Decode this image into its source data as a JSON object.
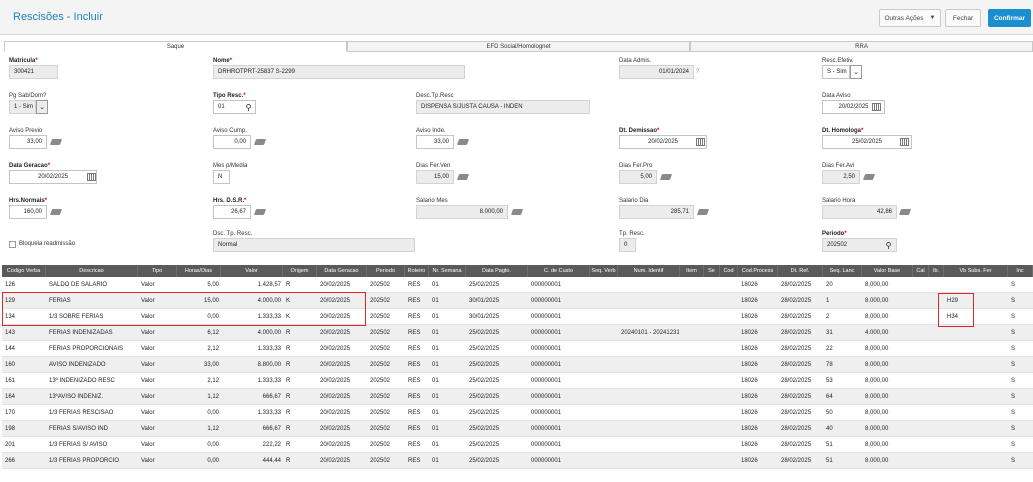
{
  "header": {
    "title": "Rescisões - Incluir",
    "actions": {
      "outras_acoes": "Outras Ações",
      "fechar": "Fechar",
      "confirmar": "Confirmar"
    }
  },
  "tabs": [
    "Saque",
    "EFD Social/Homolognet",
    "RRA"
  ],
  "form": {
    "matricula": {
      "label": "Matricula",
      "value": "300421"
    },
    "nome": {
      "label": "Nome",
      "value": "DRHROTPRT-25837  S-2299"
    },
    "data_admis": {
      "label": "Data Admis.",
      "value": "01/01/2024",
      "help": "?"
    },
    "resc_efetiv": {
      "label": "Resc.Efetiv.",
      "value": "S - Sim"
    },
    "pg_sab_dom": {
      "label": "Pg Sab/Dom?",
      "value": "1 - Sim"
    },
    "tipo_resc": {
      "label": "Tipo Resc.",
      "value": "01"
    },
    "desc_tp_resc": {
      "label": "Desc.Tp.Resc",
      "value": "DISPENSA S/JUSTA CAUSA - INDEN"
    },
    "data_aviso": {
      "label": "Data Aviso",
      "value": "20/02/2025"
    },
    "aviso_previo": {
      "label": "Aviso Previo",
      "value": "33,00"
    },
    "aviso_cump": {
      "label": "Aviso Cump.",
      "value": "0,00"
    },
    "aviso_inde": {
      "label": "Aviso Inde.",
      "value": "33,00"
    },
    "dt_demissao": {
      "label": "Dt. Demissao",
      "value": "20/02/2025"
    },
    "dt_homologa": {
      "label": "Dt. Homologa",
      "value": "25/02/2025"
    },
    "data_geracao": {
      "label": "Data Geracao",
      "value": "20/02/2025"
    },
    "mes_p_media": {
      "label": "Mes p/Media",
      "value": "N"
    },
    "dias_fer_ven": {
      "label": "Dias Fer.Ven",
      "value": "15,00"
    },
    "dias_fer_pro": {
      "label": "Dias Fer.Pro",
      "value": "5,00"
    },
    "dias_fer_avi": {
      "label": "Dias Fer.Avi",
      "value": "2,50"
    },
    "hrs_normais": {
      "label": "Hrs.Normais",
      "value": "160,00"
    },
    "hrs_dsr": {
      "label": "Hrs. D.S.R.",
      "value": "26,67"
    },
    "salario_mes": {
      "label": "Salario Mes",
      "value": "8.000,00"
    },
    "salario_dia": {
      "label": "Salario Dia",
      "value": "285,71"
    },
    "salario_hora": {
      "label": "Salario Hora",
      "value": "42,86"
    },
    "bloqueia": {
      "label": "Bloqueia readmissão"
    },
    "dsc_tp_resc": {
      "label": "Dsc. Tp. Resc.",
      "value": "Normal"
    },
    "tp_resc": {
      "label": "Tp. Resc.",
      "value": "0"
    },
    "periodo": {
      "label": "Periodo",
      "value": "202502"
    }
  },
  "grid": {
    "headers": [
      "Codigo Verba",
      "Descricao",
      "Tipo",
      "Horas/Dias",
      "Valor",
      "Origem",
      "Data Geracao",
      "Periodo",
      "Roteiro",
      "Nr. Semana",
      "Data Pagto.",
      "C. de Custo",
      "Seq. Verb",
      "Num. Identif",
      "Item",
      "Se",
      "Cod",
      "Cod.Process",
      "Dt. Ref.",
      "Seq. Lanc",
      "Valor Base",
      "Cal",
      "Ib.",
      "Vb Subs. Fer",
      "Inc"
    ],
    "rows": [
      [
        "126",
        "SALDO DE SALARIO",
        "Valor",
        "5,00",
        "1.428,57",
        "R",
        "20/02/2025",
        "202502",
        "RES",
        "01",
        "25/02/2025",
        "000000001",
        "",
        "",
        "",
        "",
        "",
        "18026",
        "28/02/2025",
        "20",
        "8.000,00",
        "",
        "",
        "",
        "S"
      ],
      [
        "129",
        "FERIAS",
        "Valor",
        "15,00",
        "4.000,00",
        "K",
        "20/02/2025",
        "202502",
        "RES",
        "01",
        "30/01/2025",
        "000000001",
        "",
        "",
        "",
        "",
        "",
        "18026",
        "28/02/2025",
        "1",
        "8.000,00",
        "",
        "",
        "H29",
        "S"
      ],
      [
        "134",
        "1/3 SOBRE FERIAS",
        "Valor",
        "0,00",
        "1.333,33",
        "K",
        "20/02/2025",
        "202502",
        "RES",
        "01",
        "30/01/2025",
        "000000001",
        "",
        "",
        "",
        "",
        "",
        "18026",
        "28/02/2025",
        "2",
        "8.000,00",
        "",
        "",
        "H34",
        "S"
      ],
      [
        "143",
        "FERIAS INDENIZADAS",
        "Valor",
        "6,12",
        "4.000,00",
        "R",
        "20/02/2025",
        "202502",
        "RES",
        "01",
        "25/02/2025",
        "000000001",
        "",
        "20240101 - 20241231",
        "",
        "",
        "",
        "18026",
        "28/02/2025",
        "31",
        "4.000,00",
        "",
        "",
        "",
        "S"
      ],
      [
        "144",
        "FERIAS PROPORCIONAIS",
        "Valor",
        "2,12",
        "1.333,33",
        "R",
        "20/02/2025",
        "202502",
        "RES",
        "01",
        "25/02/2025",
        "000000001",
        "",
        "",
        "",
        "",
        "",
        "18026",
        "28/02/2025",
        "22",
        "8.000,00",
        "",
        "",
        "",
        "S"
      ],
      [
        "160",
        "AVISO INDENIZADO",
        "Valor",
        "33,00",
        "8.800,00",
        "R",
        "20/02/2025",
        "202502",
        "RES",
        "01",
        "25/02/2025",
        "000000001",
        "",
        "",
        "",
        "",
        "",
        "18026",
        "28/02/2025",
        "78",
        "8.000,00",
        "",
        "",
        "",
        "S"
      ],
      [
        "161",
        "13º INDENIZADO RESC",
        "Valor",
        "2,12",
        "1.333,33",
        "R",
        "20/02/2025",
        "202502",
        "RES",
        "01",
        "25/02/2025",
        "000000001",
        "",
        "",
        "",
        "",
        "",
        "18026",
        "28/02/2025",
        "53",
        "8.000,00",
        "",
        "",
        "",
        "S"
      ],
      [
        "164",
        "13ºAVISO INDENIZ.",
        "Valor",
        "1,12",
        "666,67",
        "R",
        "20/02/2025",
        "202502",
        "RES",
        "01",
        "25/02/2025",
        "000000001",
        "",
        "",
        "",
        "",
        "",
        "18026",
        "28/02/2025",
        "64",
        "8.000,00",
        "",
        "",
        "",
        "S"
      ],
      [
        "170",
        "1/3 FERIAS RESCISAO",
        "Valor",
        "0,00",
        "1.333,33",
        "R",
        "20/02/2025",
        "202502",
        "RES",
        "01",
        "25/02/2025",
        "000000001",
        "",
        "",
        "",
        "",
        "",
        "18026",
        "28/02/2025",
        "50",
        "8.000,00",
        "",
        "",
        "",
        "S"
      ],
      [
        "198",
        "FERIAS S/AVISO IND",
        "Valor",
        "1,12",
        "666,67",
        "R",
        "20/02/2025",
        "202502",
        "RES",
        "01",
        "25/02/2025",
        "000000001",
        "",
        "",
        "",
        "",
        "",
        "18026",
        "28/02/2025",
        "40",
        "8.000,00",
        "",
        "",
        "",
        "S"
      ],
      [
        "201",
        "1/3 FERIAS S/ AVISO",
        "Valor",
        "0,00",
        "222,22",
        "R",
        "20/02/2025",
        "202502",
        "RES",
        "01",
        "25/02/2025",
        "000000001",
        "",
        "",
        "",
        "",
        "",
        "18026",
        "28/02/2025",
        "51",
        "8.000,00",
        "",
        "",
        "",
        "S"
      ],
      [
        "266",
        "1/3 FERIAS PROPORCIO",
        "Valor",
        "0,00",
        "444,44",
        "R",
        "20/02/2025",
        "202502",
        "RES",
        "01",
        "25/02/2025",
        "000000001",
        "",
        "",
        "",
        "",
        "",
        "18026",
        "28/02/2025",
        "51",
        "8.000,00",
        "",
        "",
        "",
        "S"
      ]
    ]
  }
}
